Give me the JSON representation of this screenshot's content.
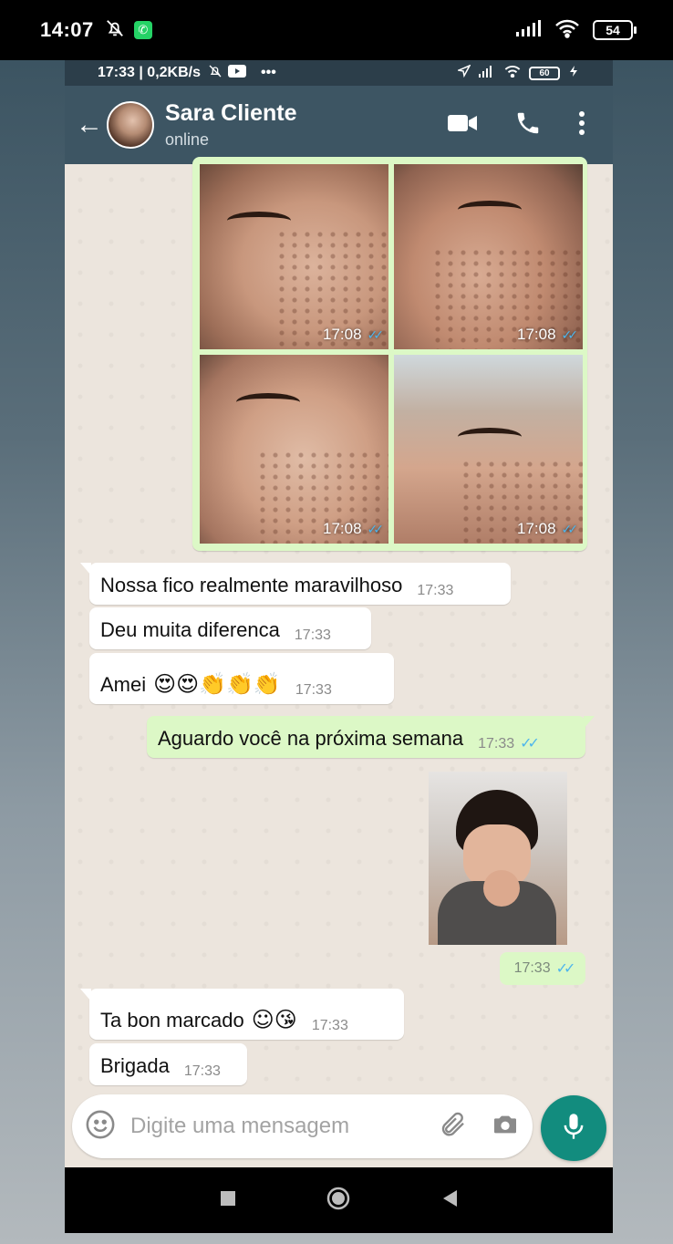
{
  "device_status": {
    "time": "14:07",
    "battery": "54"
  },
  "inner_status": {
    "time_speed": "17:33 | 0,2KB/s",
    "dots": "•••",
    "battery": "60"
  },
  "header": {
    "back": "←",
    "contact_name": "Sara Cliente",
    "contact_status": "online"
  },
  "photos": [
    {
      "time": "17:08",
      "ticks": "✓✓"
    },
    {
      "time": "17:08",
      "ticks": "✓✓"
    },
    {
      "time": "17:08",
      "ticks": "✓✓"
    },
    {
      "time": "17:08",
      "ticks": "✓✓"
    }
  ],
  "messages": [
    {
      "text": "Nossa fico realmente maravilhoso",
      "time": "17:33"
    },
    {
      "text": "Deu muita diferenca",
      "time": "17:33"
    },
    {
      "text": "Amei",
      "emojis": "😍😍👏👏👏",
      "time": "17:33"
    },
    {
      "text": "Aguardo você na próxima semana",
      "time": "17:33",
      "ticks": "✓✓"
    },
    {
      "sticker_time": "17:33",
      "ticks": "✓✓"
    },
    {
      "text": "Ta bon marcado",
      "emojis": "☺😘",
      "time": "17:33"
    },
    {
      "text": "Brigada",
      "time": "17:33"
    }
  ],
  "composer": {
    "placeholder": "Digite uma mensagem"
  },
  "colors": {
    "header": "#3d5563",
    "outgoing_bubble": "#dcf8c6",
    "mic_button": "#128c7e",
    "read_ticks": "#4fb6ec"
  },
  "icons": [
    "video-call-icon",
    "voice-call-icon",
    "menu-icon",
    "emoji-icon",
    "attach-icon",
    "camera-icon",
    "mic-icon"
  ]
}
